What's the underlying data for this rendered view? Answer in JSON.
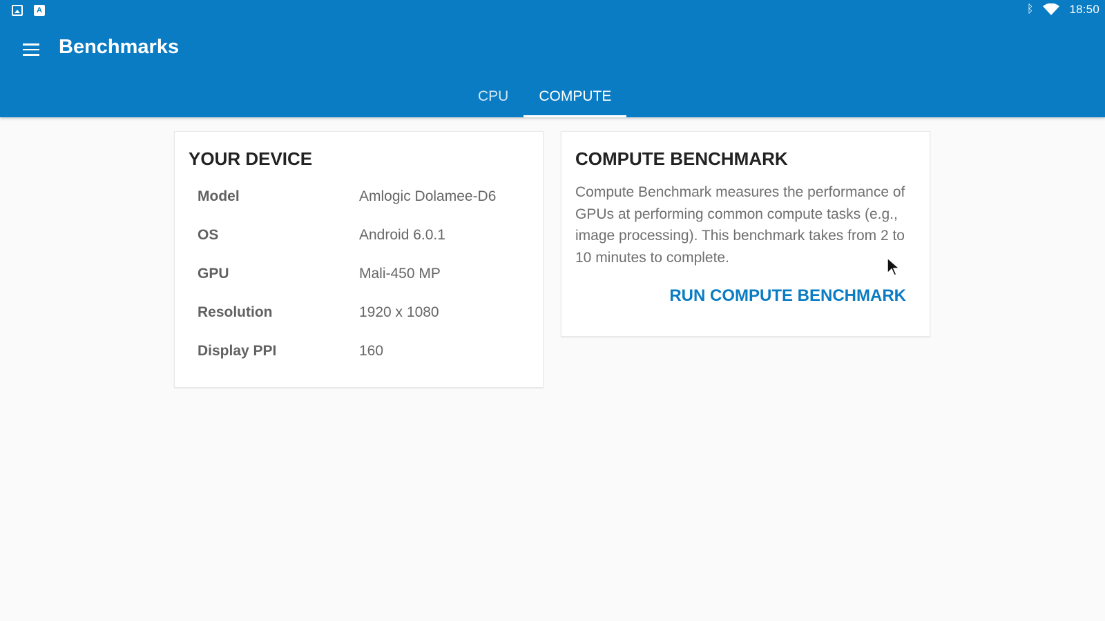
{
  "status_bar": {
    "notifications": [
      "image-icon",
      "store-icon"
    ],
    "clock": "18:50",
    "icons": [
      "bluetooth-icon",
      "wifi-icon"
    ]
  },
  "app_bar": {
    "title": "Benchmarks",
    "menu_icon": "menu-icon"
  },
  "tabs": [
    {
      "label": "CPU",
      "active": false
    },
    {
      "label": "COMPUTE",
      "active": true
    }
  ],
  "device_card": {
    "title": "YOUR DEVICE",
    "rows": [
      {
        "label": "Model",
        "value": "Amlogic Dolamee-D6"
      },
      {
        "label": "OS",
        "value": "Android 6.0.1"
      },
      {
        "label": "GPU",
        "value": "Mali-450 MP"
      },
      {
        "label": "Resolution",
        "value": "1920 x 1080"
      },
      {
        "label": "Display PPI",
        "value": "160"
      }
    ]
  },
  "compute_card": {
    "title": "COMPUTE BENCHMARK",
    "description": "Compute Benchmark measures the performance of GPUs at performing common compute tasks (e.g., image processing). This benchmark takes from 2 to 10 minutes to complete.",
    "button": "RUN COMPUTE BENCHMARK"
  },
  "colors": {
    "primary": "#0a7cc4",
    "background": "#fafafa",
    "card": "#ffffff",
    "title_text": "#222222",
    "body_text": "#666666"
  }
}
